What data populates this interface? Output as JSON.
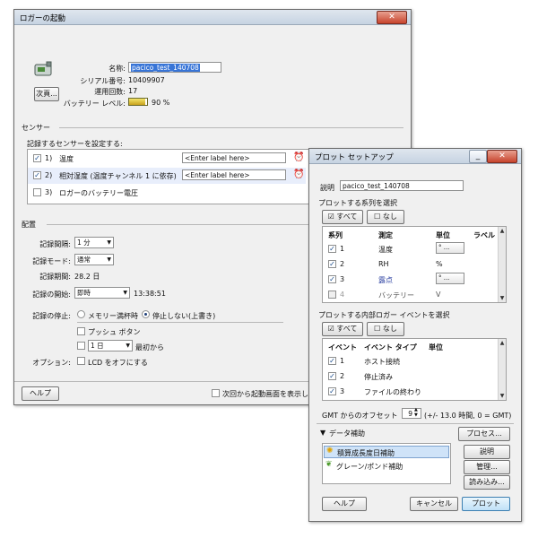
{
  "launch": {
    "title": "ロガーの起動",
    "details_button": "次頁...",
    "name_label": "名称:",
    "name_value": "pacico_test_140708",
    "serial_label": "シリアル番号:",
    "serial_value": "10409907",
    "count_label": "運用回数:",
    "count_value": "17",
    "battery_label": "バッテリー レベル:",
    "battery_value": "90 %",
    "battery_fraction": 0.9,
    "sensors_heading": "センサー",
    "sensors_sub": "記録するセンサーを設定する:",
    "sensors": [
      {
        "num": "1)",
        "name": "温度",
        "placeholder": "<Enter label here>",
        "checked": true
      },
      {
        "num": "2)",
        "name": "相対湿度 (温度チャンネル 1 に依存)",
        "placeholder": "<Enter label here>",
        "checked": true
      },
      {
        "num": "3)",
        "name": "ロガーのバッテリー電圧",
        "placeholder": "",
        "checked": false
      }
    ],
    "deploy_heading": "配置",
    "interval_label": "記録間隔:",
    "interval_value": "1 分",
    "mode_label": "記録モード:",
    "mode_value": "通常",
    "duration_label": "記録期間:",
    "duration_value": "28.2 日",
    "start_label": "記録の開始:",
    "start_value": "即時",
    "start_time": "13:38:51",
    "stop_label": "記録の停止:",
    "stop_opt_memfull": "メモリー満杯時",
    "stop_opt_never": "停止しない(上書き)",
    "push_button_opt": "プッシュ ボタン",
    "after_days_value": "1 日",
    "after_days_suffix": "最初から",
    "options_label": "オプション:",
    "lcd_option": "LCD をオフにする",
    "help_button": "ヘルプ",
    "no_show_again": "次回から起動画面を表示しない"
  },
  "plot": {
    "title": "プロット セットアップ",
    "desc_label": "説明",
    "desc_value": "pacico_test_140708",
    "series_heading": "プロットする系列を選択",
    "all_button": "すべて",
    "none_button": "なし",
    "series_columns": [
      "系列",
      "測定",
      "単位",
      "ラベル"
    ],
    "series_rows": [
      {
        "num": "1",
        "measure": "温度",
        "unit_select": "° ...",
        "checked": true,
        "enabled": true
      },
      {
        "num": "2",
        "measure": "RH",
        "unit_text": "%",
        "checked": true,
        "enabled": true
      },
      {
        "num": "3",
        "measure": "露点",
        "unit_select": "° ...",
        "checked": true,
        "enabled": true
      },
      {
        "num": "4",
        "measure": "バッテリー",
        "unit_text": "V",
        "checked": false,
        "enabled": false
      }
    ],
    "events_heading": "プロットする内部ロガー イベントを選択",
    "event_columns": [
      "イベント",
      "イベント タイプ",
      "単位"
    ],
    "event_rows": [
      {
        "num": "1",
        "name": "ホスト接続",
        "checked": true
      },
      {
        "num": "2",
        "name": "停止済み",
        "checked": true
      },
      {
        "num": "3",
        "name": "ファイルの終わり",
        "checked": true
      }
    ],
    "gmt_label": "GMT からのオフセット",
    "gmt_value": "9",
    "gmt_note": "(+/- 13.0 時間, 0 = GMT)",
    "assist_heading": "データ補助",
    "process_button": "プロセス...",
    "assists": [
      "積算成長度日補助",
      "グレーン/ポンド補助"
    ],
    "describe_button": "説明",
    "manage_button": "管理...",
    "load_button": "読み込み...",
    "help_button": "ヘルプ",
    "cancel_button": "キャンセル",
    "plot_button": "プロット"
  }
}
